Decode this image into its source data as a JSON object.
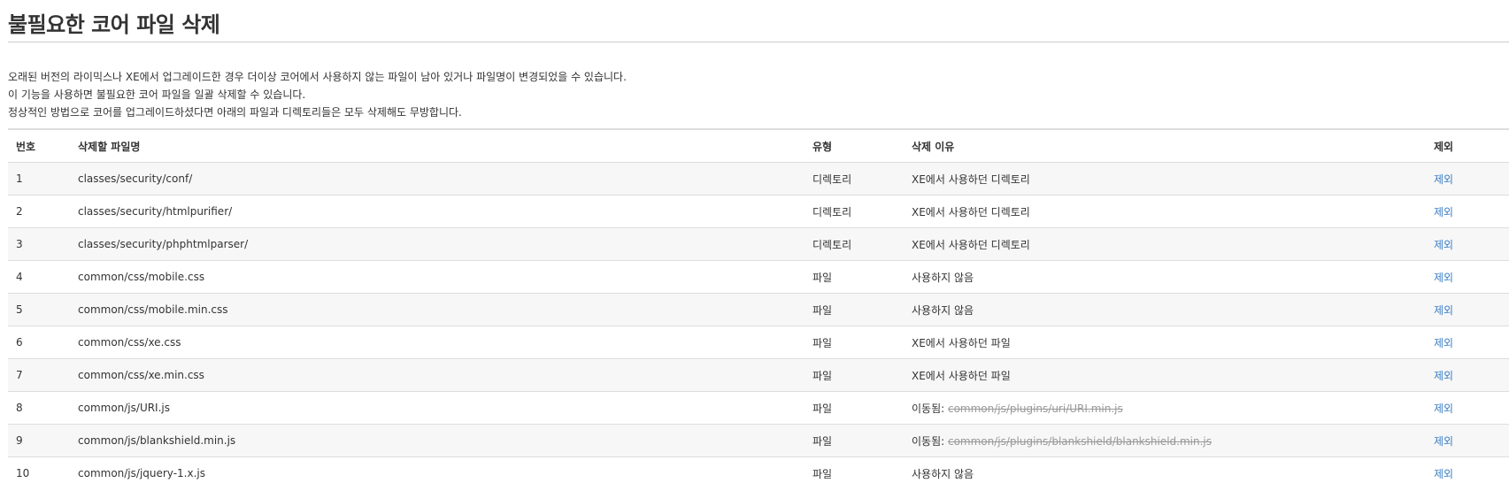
{
  "page": {
    "title": "불필요한 코어 파일 삭제",
    "description": [
      "오래된 버전의 라이믹스나 XE에서 업그레이드한 경우 더이상 코어에서 사용하지 않는 파일이 남아 있거나 파일명이 변경되었을 수 있습니다.",
      "이 기능을 사용하면 불필요한 코어 파일을 일괄 삭제할 수 있습니다.",
      "정상적인 방법으로 코어를 업그레이드하셨다면 아래의 파일과 디렉토리들은 모두 삭제해도 무방합니다."
    ]
  },
  "table": {
    "headers": {
      "num": "번호",
      "path": "삭제할 파일명",
      "type": "유형",
      "reason": "삭제 이유",
      "exclude": "제외"
    },
    "rows": [
      {
        "num": "1",
        "path": "classes/security/conf/",
        "type": "디렉토리",
        "reason": "XE에서 사용하던 디렉토리",
        "exclude": "제외"
      },
      {
        "num": "2",
        "path": "classes/security/htmlpurifier/",
        "type": "디렉토리",
        "reason": "XE에서 사용하던 디렉토리",
        "exclude": "제외"
      },
      {
        "num": "3",
        "path": "classes/security/phphtmlparser/",
        "type": "디렉토리",
        "reason": "XE에서 사용하던 디렉토리",
        "exclude": "제외"
      },
      {
        "num": "4",
        "path": "common/css/mobile.css",
        "type": "파일",
        "reason": "사용하지 않음",
        "exclude": "제외"
      },
      {
        "num": "5",
        "path": "common/css/mobile.min.css",
        "type": "파일",
        "reason": "사용하지 않음",
        "exclude": "제외"
      },
      {
        "num": "6",
        "path": "common/css/xe.css",
        "type": "파일",
        "reason": "XE에서 사용하던 파일",
        "exclude": "제외"
      },
      {
        "num": "7",
        "path": "common/css/xe.min.css",
        "type": "파일",
        "reason": "XE에서 사용하던 파일",
        "exclude": "제외"
      },
      {
        "num": "8",
        "path": "common/js/URI.js",
        "type": "파일",
        "reason": "이동됨: ",
        "moved_to": "common/js/plugins/uri/URI.min.js",
        "exclude": "제외"
      },
      {
        "num": "9",
        "path": "common/js/blankshield.min.js",
        "type": "파일",
        "reason": "이동됨: ",
        "moved_to": "common/js/plugins/blankshield/blankshield.min.js",
        "exclude": "제외"
      },
      {
        "num": "10",
        "path": "common/js/jquery-1.x.js",
        "type": "파일",
        "reason": "사용하지 않음",
        "exclude": "제외"
      }
    ]
  }
}
